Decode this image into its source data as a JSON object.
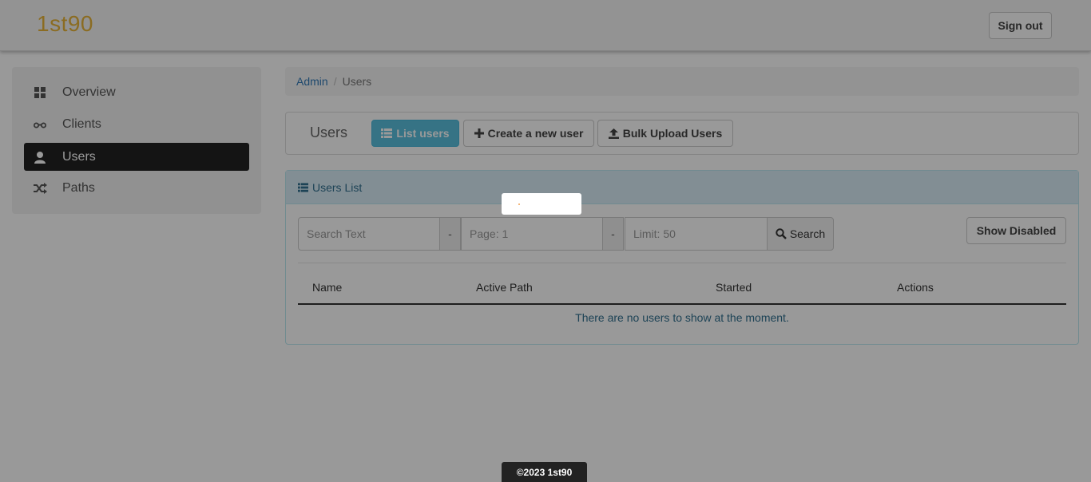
{
  "brand": "1st90",
  "header": {
    "signout_label": "Sign out"
  },
  "sidebar": {
    "items": [
      {
        "label": "Overview",
        "icon": "grid-icon"
      },
      {
        "label": "Clients",
        "icon": "glasses-icon"
      },
      {
        "label": "Users",
        "icon": "user-icon",
        "active": true
      },
      {
        "label": "Paths",
        "icon": "shuffle-icon"
      }
    ]
  },
  "breadcrumb": {
    "parent": "Admin",
    "current": "Users"
  },
  "toolbar": {
    "title": "Users",
    "list_label": "List users",
    "create_label": "Create a new user",
    "bulk_label": "Bulk Upload Users"
  },
  "panel": {
    "title": "Users List",
    "search": {
      "text_placeholder": "Search Text",
      "page_placeholder": "Page: 1",
      "limit_placeholder": "Limit: 50",
      "separator": "-",
      "button_label": "Search"
    },
    "show_disabled_label": "Show Disabled",
    "columns": [
      "Name",
      "Active Path",
      "Started",
      "Actions"
    ],
    "empty_message": "There are no users to show at the moment."
  },
  "footer": "©2023 1st90",
  "colors": {
    "brand": "#e8b53a",
    "primary": "#5bc0de",
    "info_text": "#31708f"
  }
}
